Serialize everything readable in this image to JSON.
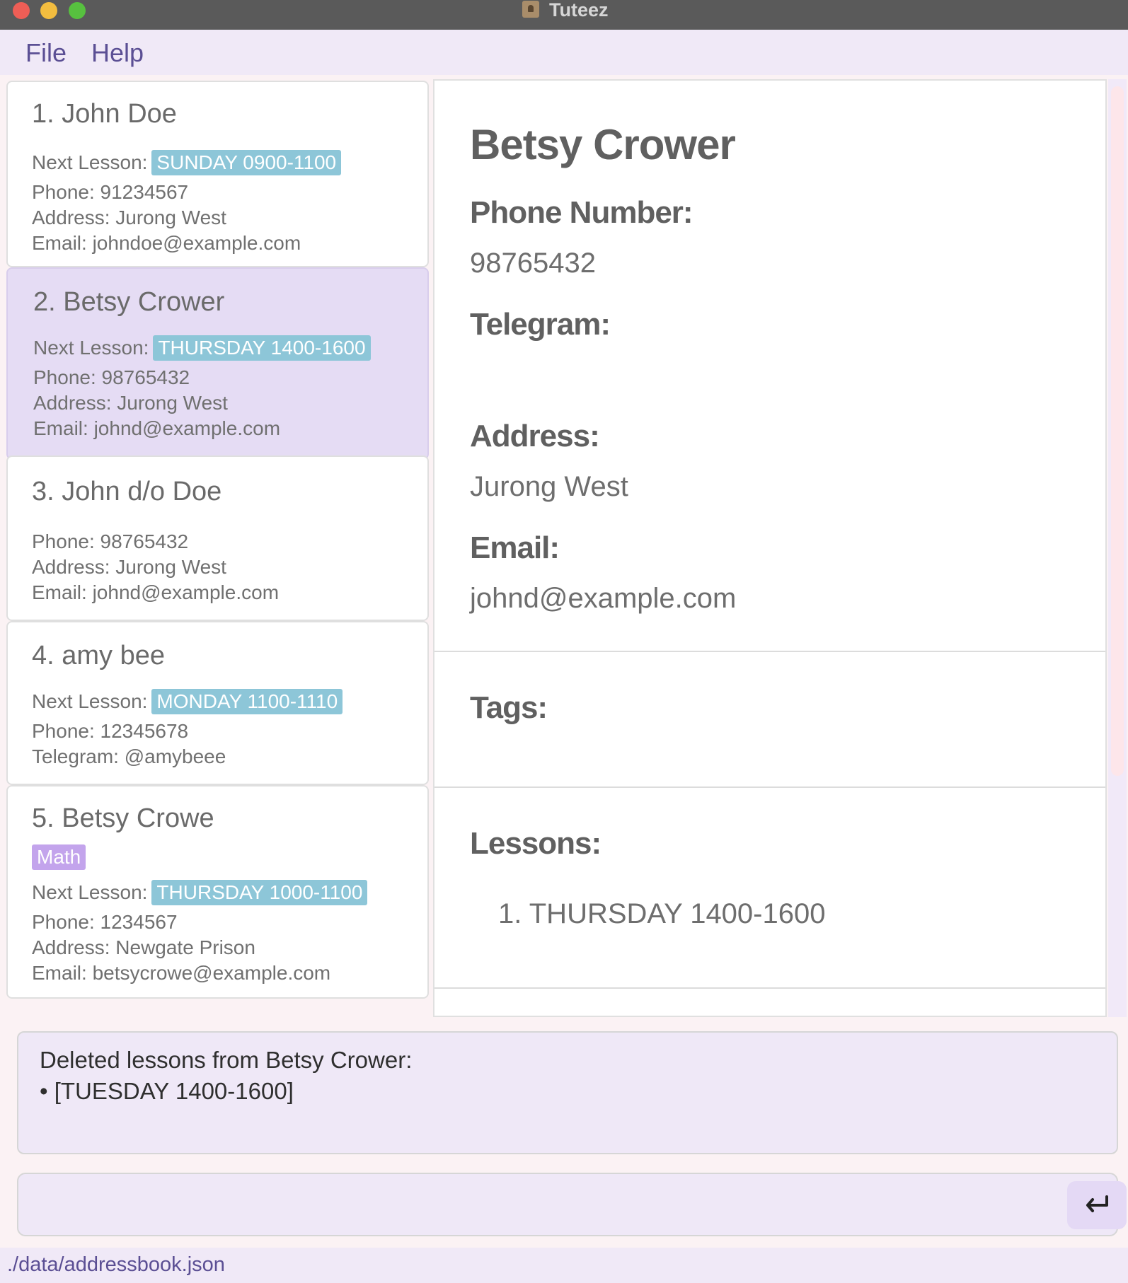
{
  "window": {
    "title": "Tuteez"
  },
  "menu": {
    "file": "File",
    "help": "Help"
  },
  "persons": [
    {
      "name": "1. John Doe",
      "lesson_label": "Next Lesson:",
      "lesson": "SUNDAY 0900-1100",
      "phone": "Phone:  91234567",
      "address": "Address:  Jurong West",
      "email": "Email:  johndoe@example.com"
    },
    {
      "name": "2. Betsy Crower",
      "lesson_label": "Next Lesson:",
      "lesson": "THURSDAY 1400-1600",
      "phone": "Phone:  98765432",
      "address": "Address:  Jurong West",
      "email": "Email:  johnd@example.com"
    },
    {
      "name": "3. John d/o Doe",
      "phone": "Phone:  98765432",
      "address": "Address:  Jurong West",
      "email": "Email:  johnd@example.com"
    },
    {
      "name": "4. amy bee",
      "lesson_label": "Next Lesson:",
      "lesson": "MONDAY 1100-1110",
      "phone": "Phone:  12345678",
      "telegram": "Telegram:  @amybeee"
    },
    {
      "name": "5. Betsy Crowe",
      "tag": "Math",
      "lesson_label": "Next Lesson:",
      "lesson": "THURSDAY 1000-1100",
      "phone": "Phone:  1234567",
      "address": "Address:  Newgate Prison",
      "email": "Email:  betsycrowe@example.com"
    }
  ],
  "detail": {
    "name": "Betsy Crower",
    "phone_label": "Phone Number:",
    "phone": "98765432",
    "telegram_label": "Telegram:",
    "telegram": "",
    "address_label": "Address:",
    "address": "Jurong West",
    "email_label": "Email:",
    "email": "johnd@example.com",
    "tags_label": "Tags:",
    "lessons_label": "Lessons:",
    "lessons": [
      "1. THURSDAY 1400-1600"
    ]
  },
  "result": {
    "line1": "Deleted lessons from Betsy Crower:",
    "line2": "• [TUESDAY 1400-1600]"
  },
  "command": {
    "value": "",
    "placeholder": ""
  },
  "status": {
    "path": "./data/addressbook.json"
  },
  "colors": {
    "lesson_badge": "#8dc6d8",
    "tag_badge": "#c3a4ec",
    "selected_card": "#e5dcf4",
    "menu_text": "#5b4f94"
  }
}
